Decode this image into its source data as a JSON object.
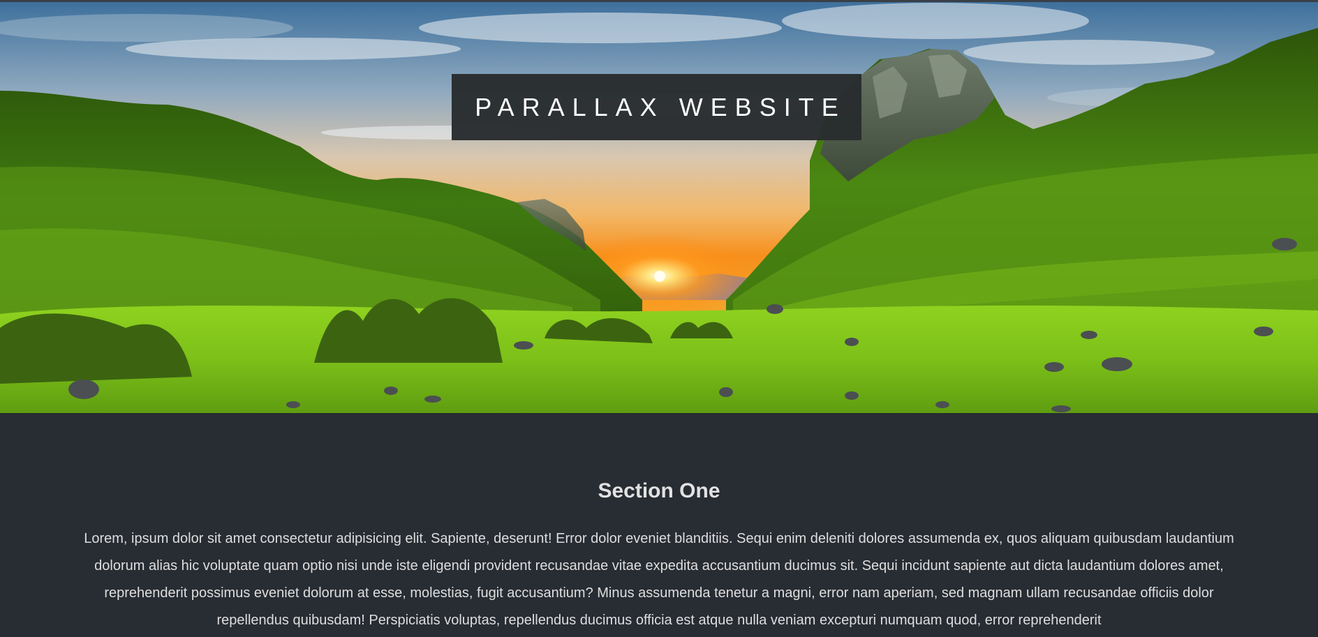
{
  "hero": {
    "title": "PARALLAX WEBSITE",
    "image": "landscape-valley-sunset",
    "colors": {
      "sky_top": "#3f78a8",
      "sunset": "#f7a21a",
      "grass": "#7cc019",
      "title_box": "#282c2e"
    }
  },
  "section_one": {
    "heading": "Section One",
    "body": "Lorem, ipsum dolor sit amet consectetur adipisicing elit. Sapiente, deserunt! Error dolor eveniet blanditiis. Sequi enim deleniti dolores assumenda ex, quos aliquam quibusdam laudantium dolorum alias hic voluptate quam optio nisi unde iste eligendi provident recusandae vitae expedita accusantium ducimus sit. Sequi incidunt sapiente aut dicta laudantium dolores amet, reprehenderit possimus eveniet dolorum at esse, molestias, fugit accusantium? Minus assumenda tenetur a magni, error nam aperiam, sed magnam ullam recusandae officiis dolor repellendus quibusdam! Perspiciatis voluptas, repellendus ducimus officia est atque nulla veniam excepturi numquam quod, error reprehenderit",
    "background": "#282c33"
  }
}
